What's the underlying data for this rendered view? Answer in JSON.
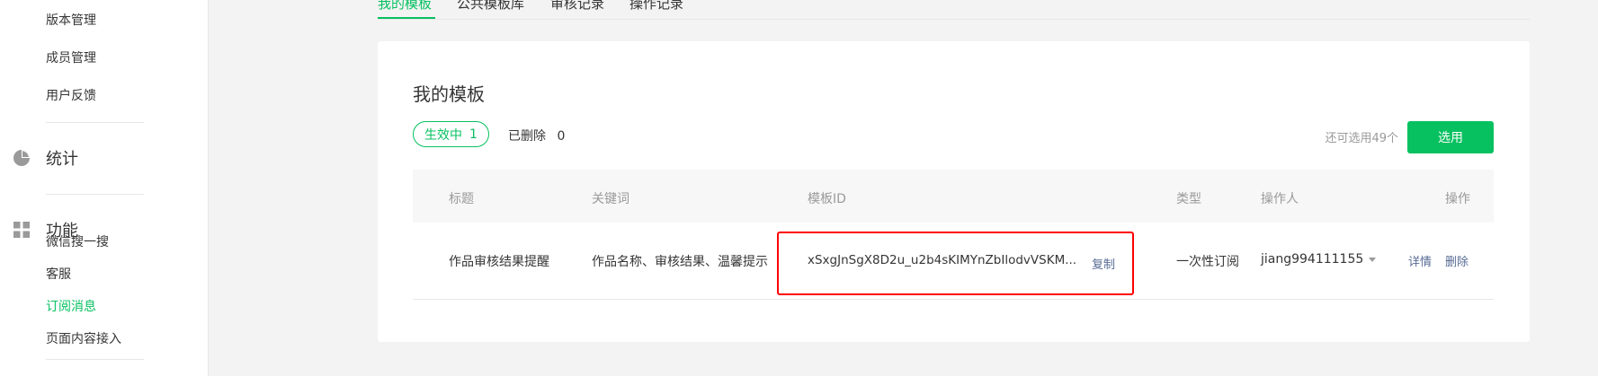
{
  "sidebar": {
    "items_top": [
      "版本管理",
      "成员管理",
      "用户反馈"
    ],
    "group_stats": {
      "label": "统计",
      "icon": "pie-chart-icon"
    },
    "group_features": {
      "label": "功能",
      "icon": "grid-icon"
    },
    "items_features": [
      "微信搜一搜",
      "客服",
      "订阅消息",
      "页面内容接入"
    ],
    "active_item": "订阅消息"
  },
  "tabs": [
    "我的模板",
    "公共模板库",
    "审核记录",
    "操作记录"
  ],
  "active_tab": "我的模板",
  "card": {
    "title": "我的模板",
    "filter_active": {
      "label": "生效中",
      "count": "1"
    },
    "filter_deleted": {
      "label": "已删除",
      "count": "0"
    },
    "remaining": "还可选用49个",
    "select_button": "选用"
  },
  "table": {
    "headers": [
      "标题",
      "关键词",
      "模板ID",
      "类型",
      "操作人",
      "操作"
    ],
    "rows": [
      {
        "title": "作品审核结果提醒",
        "keywords": "作品名称、审核结果、温馨提示",
        "template_id": "xSxgJnSgX8D2u_u2b4sKIMYnZbIlodvVSKM...",
        "copy": "复制",
        "type": "一次性订阅",
        "operator": "jiang994111155",
        "action_detail": "详情",
        "action_delete": "删除"
      }
    ]
  },
  "colors": {
    "brand": "#07c160",
    "link": "#576b95",
    "highlight": "#ff0000"
  }
}
